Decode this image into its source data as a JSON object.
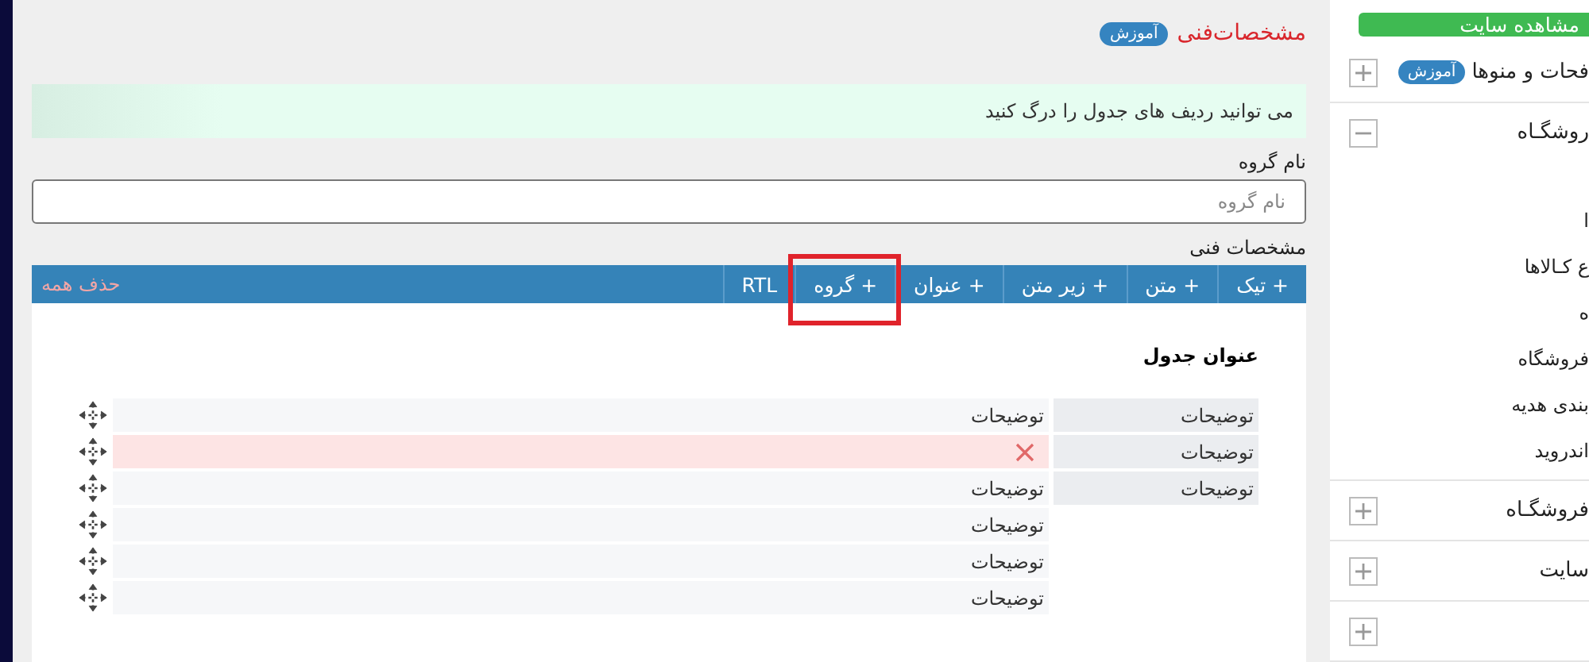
{
  "sidebar": {
    "view_site_button": "مشاهده سایت",
    "sections": [
      {
        "label": "فحات و منوها",
        "badge": "آموزش",
        "expanded": false
      },
      {
        "label": "روشگـاه",
        "expanded": true,
        "items": [
          "ا",
          "ع کـالاها",
          "ه",
          "فروشگاه",
          "بندی هدیه",
          "اندروید"
        ]
      },
      {
        "label": "فروشگـاه",
        "expanded": false
      },
      {
        "label": "سایت",
        "expanded": false
      },
      {
        "expanded": false
      }
    ]
  },
  "page": {
    "title": "مشخصات‌فنی",
    "badge": "آموزش",
    "notice": "می توانید ردیف های جدول را درگ کنید",
    "group_name": {
      "label": "نام گروه",
      "placeholder": "نام گروه"
    },
    "specs_label": "مشخصات فنی",
    "toolbar": [
      {
        "label": "+ تیک",
        "annotated": false
      },
      {
        "label": "+ متن",
        "annotated": false
      },
      {
        "label": "+ زیر متن",
        "annotated": false
      },
      {
        "label": "+ عنوان",
        "annotated": false
      },
      {
        "label": "+ گروه",
        "annotated": true
      },
      {
        "label": "RTL",
        "annotated": false
      }
    ],
    "delete_all": "حذف همه",
    "table_title": "عنوان جدول",
    "rows": [
      {
        "key": "توضیحات",
        "value": "توضیحات",
        "deleting": false
      },
      {
        "key": "توضیحات",
        "deleting": true
      },
      {
        "key": "توضیحات",
        "value": "توضیحات",
        "deleting": false
      },
      {
        "value": "توضیحات",
        "deleting": false
      },
      {
        "value": "توضیحات",
        "deleting": false
      },
      {
        "value": "توضیحات",
        "deleting": false
      }
    ]
  }
}
